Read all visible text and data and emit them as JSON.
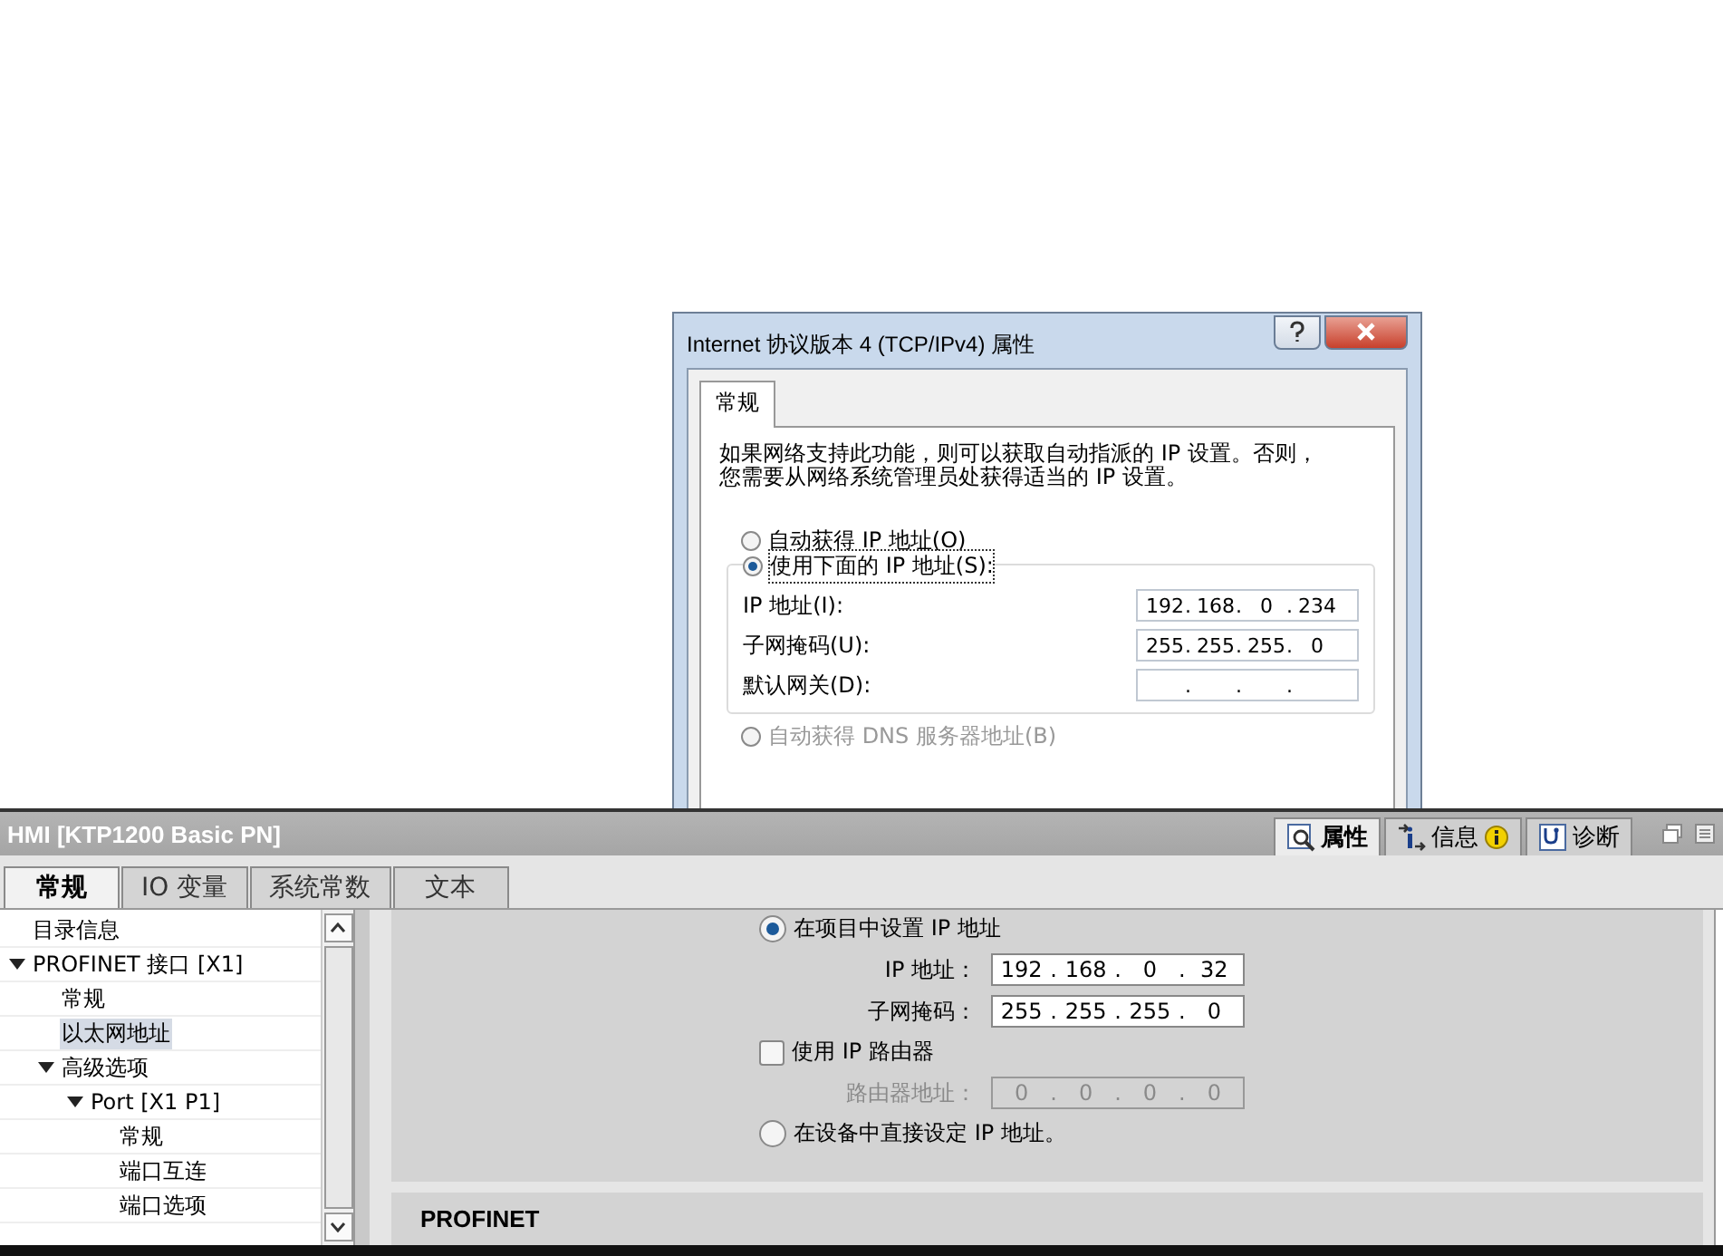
{
  "dialog": {
    "title": "Internet 协议版本 4 (TCP/IPv4) 属性",
    "tabs": [
      {
        "label": "常规",
        "selected": true
      }
    ],
    "description": "如果网络支持此功能，则可以获取自动指派的 IP 设置。否则，您需要从网络系统管理员处获得适当的 IP 设置。",
    "ip_options": [
      {
        "label": "自动获得 IP 地址(O)",
        "selected": false
      },
      {
        "label": "使用下面的 IP 地址(S):",
        "selected": true
      }
    ],
    "fields": [
      {
        "label": "IP 地址(I):",
        "octets": [
          "192",
          "168",
          "0",
          "234"
        ]
      },
      {
        "label": "子网掩码(U):",
        "octets": [
          "255",
          "255",
          "255",
          "0"
        ]
      },
      {
        "label": "默认网关(D):"
      }
    ],
    "separator": ".",
    "dns_options": [
      {
        "label": "自动获得 DNS 服务器地址(B)",
        "selected": false,
        "disabled": true
      }
    ]
  },
  "panel": {
    "title": "HMI [KTP1200 Basic PN]",
    "view_tabs": [
      {
        "label": "属性",
        "selected": true,
        "kind": "properties"
      },
      {
        "label": "信息",
        "selected": false,
        "kind": "info"
      },
      {
        "label": "诊断",
        "selected": false,
        "kind": "diagnostics"
      }
    ],
    "tabs": [
      {
        "label": "常规",
        "selected": true
      },
      {
        "label": "IO 变量",
        "selected": false
      },
      {
        "label": "系统常数",
        "selected": false
      },
      {
        "label": "文本",
        "selected": false
      }
    ],
    "tree": [
      {
        "label": "目录信息",
        "selected": false
      },
      {
        "label": "PROFINET 接口 [X1]",
        "selected": false,
        "expanded": true,
        "children": [
          {
            "label": "常规",
            "selected": false
          },
          {
            "label": "以太网地址",
            "selected": true
          },
          {
            "label": "高级选项",
            "selected": false,
            "expanded": true,
            "children": [
              {
                "label": "Port [X1 P1]",
                "selected": false,
                "expanded": true,
                "children": [
                  {
                    "label": "常规",
                    "selected": false
                  },
                  {
                    "label": "端口互连",
                    "selected": false
                  },
                  {
                    "label": "端口选项",
                    "selected": false
                  }
                ]
              }
            ]
          }
        ]
      }
    ],
    "ip_settings": {
      "modes": [
        {
          "label": "在项目中设置 IP 地址",
          "selected": true
        },
        {
          "label": "在设备中直接设定 IP 地址。",
          "selected": false
        }
      ],
      "fields": [
        {
          "label": "IP 地址：",
          "octets": [
            "192",
            "168",
            "0",
            "32"
          ]
        },
        {
          "label": "子网掩码：",
          "octets": [
            "255",
            "255",
            "255",
            "0"
          ]
        }
      ],
      "router": {
        "label": "使用 IP 路由器",
        "checked": false
      },
      "router_field": {
        "label": "路由器地址：",
        "octets": [
          "0",
          "0",
          "0",
          "0"
        ]
      },
      "separator": "."
    },
    "section_title": "PROFINET"
  }
}
